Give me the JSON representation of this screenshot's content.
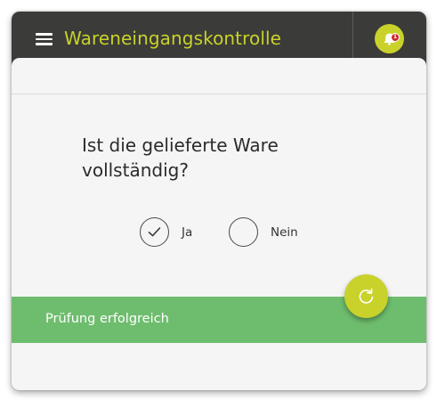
{
  "header": {
    "title": "Wareneingangskontrolle",
    "menu_icon": "hamburger-menu-icon",
    "notification_icon": "bell-icon",
    "notification_count": "1",
    "accent_color": "#c8d22a",
    "background_color": "#3b3b39"
  },
  "question": {
    "text": "Ist die gelieferte Ware vollständig?"
  },
  "options": [
    {
      "label": "Ja",
      "selected": true,
      "icon": "checkmark-icon"
    },
    {
      "label": "Nein",
      "selected": false
    }
  ],
  "status": {
    "text": "Prüfung erfolgreich",
    "color": "#6ebd6e"
  },
  "fab": {
    "icon": "refresh-icon",
    "color": "#c8d22a"
  }
}
